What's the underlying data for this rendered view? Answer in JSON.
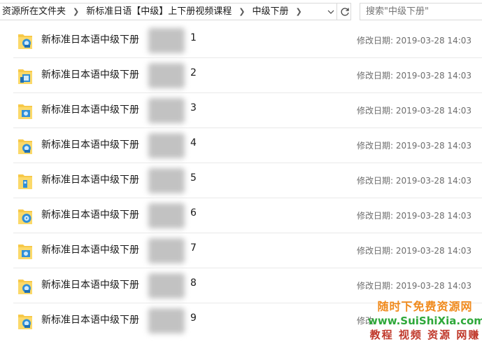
{
  "address_bar": {
    "breadcrumbs": [
      "资源所在文件夹",
      "新标准日语【中级】上下册视频课程",
      "中级下册"
    ],
    "search_placeholder": "搜索\"中级下册\""
  },
  "files": [
    {
      "name": "新标准日本语中级下册",
      "number": "1",
      "modified_label": "修改日期:",
      "modified_value": "2019-03-28 14:03"
    },
    {
      "name": "新标准日本语中级下册",
      "number": "2",
      "modified_label": "修改日期:",
      "modified_value": "2019-03-28 14:03"
    },
    {
      "name": "新标准日本语中级下册",
      "number": "3",
      "modified_label": "修改日期:",
      "modified_value": "2019-03-28 14:03"
    },
    {
      "name": "新标准日本语中级下册",
      "number": "4",
      "modified_label": "修改日期:",
      "modified_value": "2019-03-28 14:03"
    },
    {
      "name": "新标准日本语中级下册",
      "number": "5",
      "modified_label": "修改日期:",
      "modified_value": "2019-03-28 14:03"
    },
    {
      "name": "新标准日本语中级下册",
      "number": "6",
      "modified_label": "修改日期:",
      "modified_value": "2019-03-28 14:03"
    },
    {
      "name": "新标准日本语中级下册",
      "number": "7",
      "modified_label": "修改日期:",
      "modified_value": "2019-03-28 14:03"
    },
    {
      "name": "新标准日本语中级下册",
      "number": "8",
      "modified_label": "修改日期:",
      "modified_value": "2019-03-28 14:03"
    },
    {
      "name": "新标准日本语中级下册",
      "number": "9",
      "modified_label": "修改",
      "modified_value": ""
    }
  ],
  "icons": {
    "folder": "folder-with-media-icon",
    "dropdown": "chevron-down-icon",
    "refresh": "refresh-icon",
    "breadcrumb_separator": "chevron-right-icon"
  },
  "colors": {
    "folder_yellow": "#f7c948",
    "folder_overlay_blue": "#2f8fd8",
    "divider": "#e9e9e9",
    "secondary_text": "#6d6d6d"
  },
  "watermark": {
    "line1": "随时下免费资源网",
    "line2": "www.SuiShiXia.com",
    "line3": "教程 视频 资源 网赚"
  }
}
